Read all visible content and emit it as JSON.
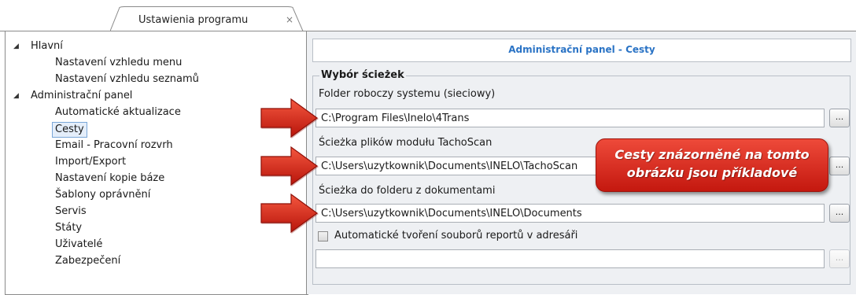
{
  "tab": {
    "title": "Ustawienia programu",
    "close": "×"
  },
  "tree": {
    "groups": [
      {
        "label": "Hlavní",
        "items": [
          "Nastavení vzhledu menu",
          "Nastavení vzhledu seznamů"
        ]
      },
      {
        "label": "Administrační panel",
        "items": [
          "Automatické aktualizace",
          "Cesty",
          "Email - Pracovní rozvrh",
          "Import/Export",
          "Nastavení kopie báze",
          "Šablony oprávnění",
          "Servis",
          "Státy",
          "Uživatelé",
          "Zabezpečení"
        ]
      }
    ],
    "selected": "Cesty",
    "expand_glyph": "◢"
  },
  "panel": {
    "header": "Administrační panel - Cesty",
    "group_title": "Wybór ścieżek",
    "fields": [
      {
        "label": "Folder roboczy systemu (sieciowy)",
        "value": "C:\\Program Files\\Inelo\\4Trans",
        "button": "..."
      },
      {
        "label": "Ścieżka plików modułu TachoScan",
        "value": "C:\\Users\\uzytkownik\\Documents\\INELO\\TachoScan",
        "button": "..."
      },
      {
        "label": "Ścieżka do folderu z dokumentami",
        "value": "C:\\Users\\uzytkownik\\Documents\\INELO\\Documents",
        "button": "..."
      }
    ],
    "checkbox": {
      "label": "Automatické tvoření souborů reportů v adresáři",
      "checked": false
    },
    "report_path": {
      "value": "",
      "button": "..."
    }
  },
  "callout": {
    "line1": "Cesty znázorněné na tomto",
    "line2": "obrázku jsou příkladové"
  },
  "colors": {
    "accent": "#2a73c5",
    "callout": "#d82b1e",
    "arrow": "#d42a1c",
    "panel_bg": "#eef0f3"
  }
}
